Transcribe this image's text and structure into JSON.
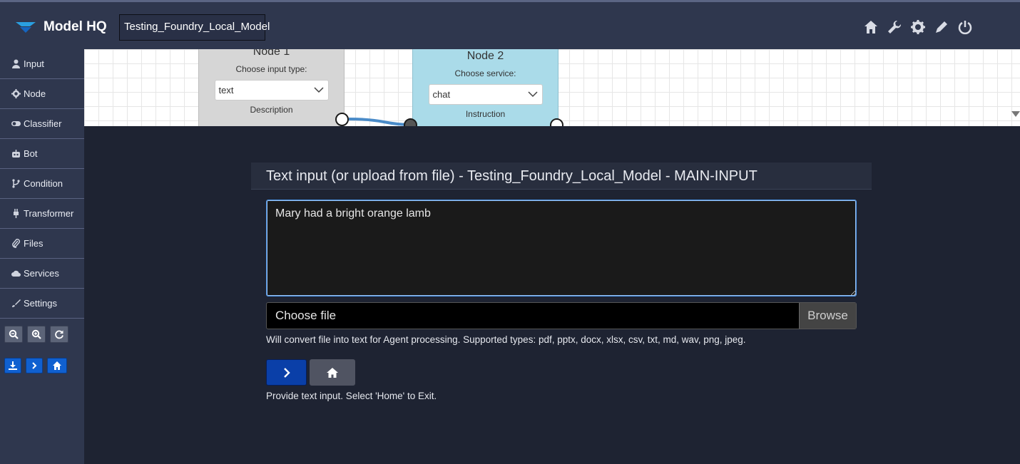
{
  "header": {
    "app_title": "Model HQ",
    "project_name": "Testing_Foundry_Local_Model",
    "icons": [
      "home-icon",
      "wrench-icon",
      "gear-icon",
      "pencil-icon",
      "power-icon"
    ]
  },
  "sidebar": {
    "items": [
      {
        "label": "Input",
        "icon": "user-icon"
      },
      {
        "label": "Node",
        "icon": "gear-icon"
      },
      {
        "label": "Classifier",
        "icon": "toggle-icon"
      },
      {
        "label": "Bot",
        "icon": "robot-icon"
      },
      {
        "label": "Condition",
        "icon": "branch-icon"
      },
      {
        "label": "Transformer",
        "icon": "plug-icon"
      },
      {
        "label": "Files",
        "icon": "paperclip-icon"
      },
      {
        "label": "Services",
        "icon": "cloud-icon"
      },
      {
        "label": "Settings",
        "icon": "brush-icon"
      }
    ],
    "zoom_tools": [
      "zoom-out-icon",
      "zoom-in-icon",
      "refresh-icon"
    ],
    "action_tools": [
      "download-icon",
      "next-icon",
      "home-icon"
    ]
  },
  "canvas": {
    "node1": {
      "title": "Node 1",
      "sub": "Choose input type:",
      "value": "text",
      "desc": "Description"
    },
    "node2": {
      "title": "Node 2",
      "sub": "Choose service:",
      "value": "chat",
      "desc": "Instruction"
    }
  },
  "main": {
    "title": "Text input (or upload from file) - Testing_Foundry_Local_Model - MAIN-INPUT",
    "text_value": "Mary had a bright orange lamb",
    "file_label": "Choose file",
    "browse_label": "Browse",
    "help_text": "Will convert file into text for Agent processing. Supported types: pdf, pptx, docx, xlsx, csv, txt, md, wav, png, jpeg.",
    "instructions": "Provide text input. Select 'Home' to Exit."
  },
  "colors": {
    "header_bg": "#2f374e",
    "body_bg": "#1e2332",
    "node2_bg": "#aadbe9",
    "next_button": "#0a3fa8"
  }
}
